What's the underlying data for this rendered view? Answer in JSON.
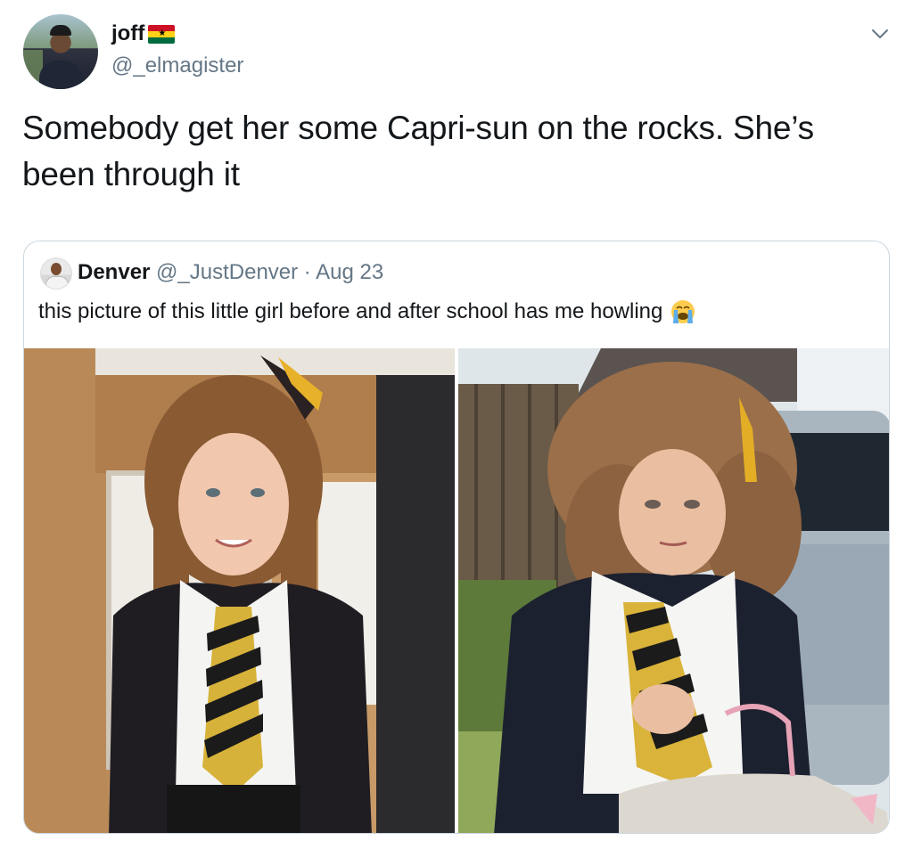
{
  "tweet": {
    "display_name": "joff",
    "handle": "@_elmagister",
    "text": "Somebody get her some Capri-sun on the rocks. She’s been through it",
    "flag_icon": "ghana-flag-icon",
    "menu_icon": "chevron-down-icon"
  },
  "quoted_tweet": {
    "display_name": "Denver",
    "handle": "@_JustDenver",
    "separator": " · ",
    "date": "Aug 23",
    "text": "this picture of this little girl before and after school has me howling",
    "emoji": "loudly-crying-face-icon",
    "photos": [
      {
        "name": "before-school-photo"
      },
      {
        "name": "after-school-photo"
      }
    ]
  },
  "colors": {
    "text": "#14171a",
    "secondary_text": "#657786",
    "border": "#ccd6dd",
    "background": "#ffffff"
  }
}
